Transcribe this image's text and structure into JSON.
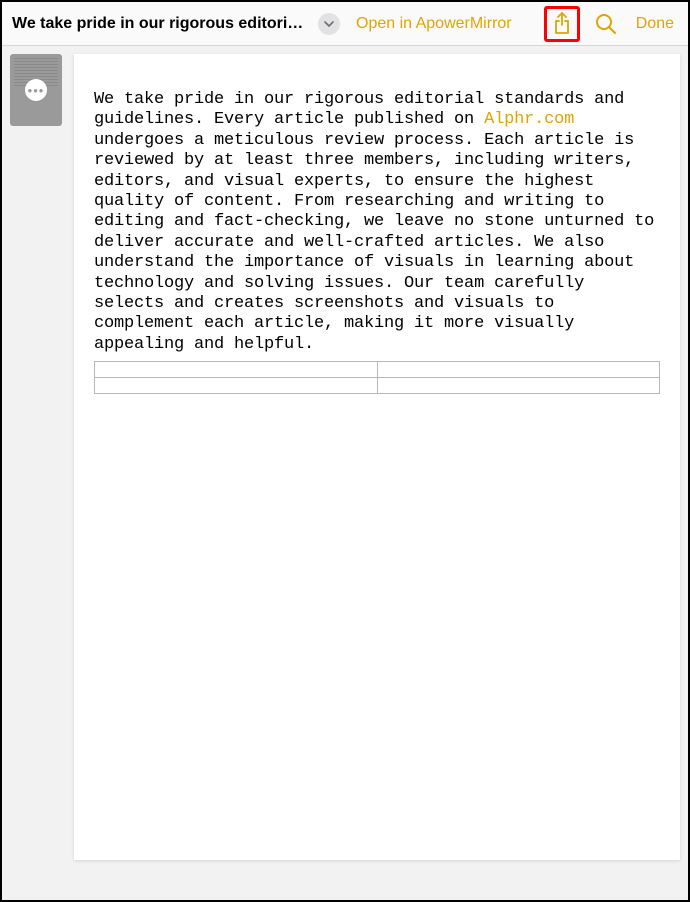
{
  "toolbar": {
    "title": "We take pride in our rigorous editorial sta...",
    "open_in_label": "Open in ApowerMirror",
    "done_label": "Done"
  },
  "document": {
    "text_before_link": "We take pride in our rigorous editorial standards and guidelines. Every article published on ",
    "link_text": "Alphr.com",
    "text_after_link": " undergoes a meticulous review process. Each article is reviewed by at least three members, including writers, editors, and visual experts, to ensure the highest quality of content. From researching and writing to editing and fact-checking, we leave no stone unturned to deliver accurate and well-crafted articles. We also understand the importance of visuals in learning about technology and solving issues. Our team carefully selects and creates screenshots and visuals to complement each article, making it more visually appealing and helpful."
  }
}
